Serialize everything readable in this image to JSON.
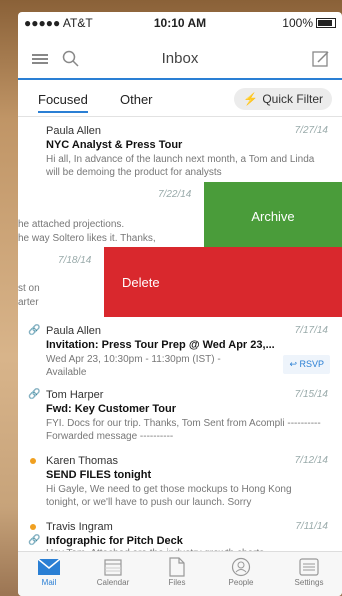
{
  "status": {
    "carrier": "●●●●● AT&T",
    "time": "10:10 AM",
    "battery": "100%"
  },
  "header": {
    "title": "Inbox"
  },
  "tabs": {
    "focused": "Focused",
    "other": "Other",
    "quick_filter": "Quick Filter"
  },
  "messages": [
    {
      "from": "Paula Allen",
      "date": "7/27/14",
      "subject": "NYC Analyst & Press Tour",
      "preview": "Hi all, In advance of the launch next month, a Tom and Linda will be demoing the product for analysts"
    }
  ],
  "swipe_archive": {
    "date": "7/22/14",
    "preview_l1": "he attached projections.",
    "preview_l2": "he way Soltero likes it. Thanks,",
    "action": "Archive"
  },
  "swipe_delete": {
    "date": "7/18/14",
    "preview_l1": "st on",
    "preview_l2": "arter",
    "action": "Delete"
  },
  "messages2": [
    {
      "from": "Paula Allen",
      "date": "7/17/14",
      "subject": "Invitation: Press Tour Prep @ Wed Apr 23,...",
      "preview": "Wed Apr 23, 10:30pm - 11:30pm (IST) - Available",
      "rsvp": "RSVP"
    },
    {
      "from": "Tom Harper",
      "date": "7/15/14",
      "subject": "Fwd: Key Customer Tour",
      "preview": "FYI. Docs for our trip. Thanks, Tom Sent from Acompli ---------- Forwarded message ----------"
    },
    {
      "from": "Karen Thomas",
      "date": "7/12/14",
      "subject": "SEND FILES tonight",
      "preview": "Hi Gayle, We need to get those mockups to Hong Kong tonight, or we'll have to push our launch. Sorry"
    },
    {
      "from": "Travis Ingram",
      "date": "7/11/14",
      "subject": "Infographic for Pitch Deck",
      "preview": "Hey Tom, Attached are the industry growth charts"
    }
  ],
  "bottom_nav": [
    "Mail",
    "Calendar",
    "Files",
    "People",
    "Settings"
  ],
  "colors": {
    "accent": "#2a7fd4",
    "archive": "#4a9c3a",
    "delete": "#d9282d",
    "unread_dot": "#f0a020"
  }
}
